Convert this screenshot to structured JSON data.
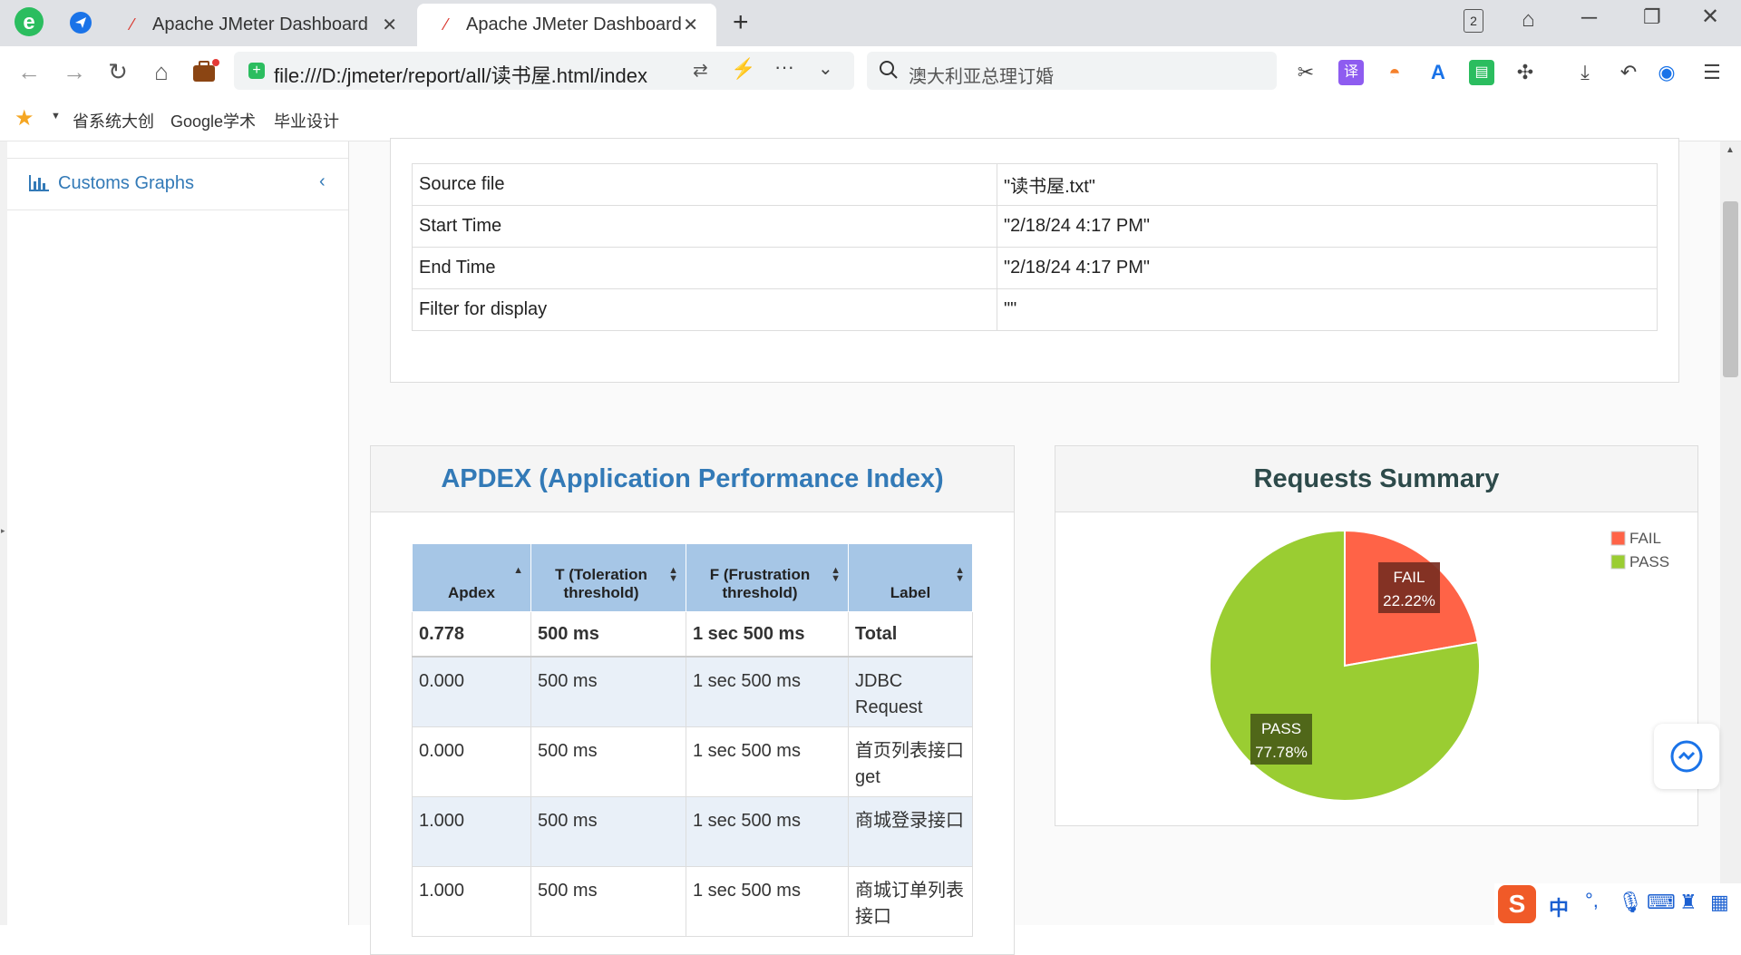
{
  "browser": {
    "tabs": [
      {
        "title": "Apache JMeter Dashboard",
        "active": false
      },
      {
        "title": "Apache JMeter Dashboard",
        "active": true
      }
    ],
    "tab_count_badge": "2",
    "url": "file:///D:/jmeter/report/all/读书屋.html/index",
    "search_placeholder": "澳大利亚总理订婚",
    "bookmarks": [
      "省系统大创",
      "Google学术",
      "毕业设计"
    ]
  },
  "sidebar": {
    "item_label": "Customs Graphs",
    "item_icon": "bar-chart-icon"
  },
  "source_info": {
    "rows": [
      {
        "key": "Source file",
        "value": "\"读书屋.txt\""
      },
      {
        "key": "Start Time",
        "value": "\"2/18/24 4:17 PM\""
      },
      {
        "key": "End Time",
        "value": "\"2/18/24 4:17 PM\""
      },
      {
        "key": "Filter for display",
        "value": "\"\""
      }
    ]
  },
  "apdex": {
    "title": "APDEX (Application Performance Index)",
    "headers": [
      "Apdex",
      "T (Toleration threshold)",
      "F (Frustration threshold)",
      "Label"
    ],
    "total": [
      "0.778",
      "500 ms",
      "1 sec 500 ms",
      "Total"
    ],
    "rows": [
      [
        "0.000",
        "500 ms",
        "1 sec 500 ms",
        "JDBC Request"
      ],
      [
        "0.000",
        "500 ms",
        "1 sec 500 ms",
        "首页列表接口get"
      ],
      [
        "1.000",
        "500 ms",
        "1 sec 500 ms",
        "商城登录接口"
      ],
      [
        "1.000",
        "500 ms",
        "1 sec 500 ms",
        "商城订单列表接口"
      ]
    ]
  },
  "requests_summary": {
    "title": "Requests Summary"
  },
  "chart_data": {
    "type": "pie",
    "title": "Requests Summary",
    "slices": [
      {
        "label": "FAIL",
        "value": 22.22,
        "display": "22.22%",
        "color": "#ff6347"
      },
      {
        "label": "PASS",
        "value": 77.78,
        "display": "77.78%",
        "color": "#9acd32"
      }
    ],
    "legend": [
      "FAIL",
      "PASS"
    ],
    "legend_position": "top-right"
  },
  "ime": {
    "label": "中"
  }
}
